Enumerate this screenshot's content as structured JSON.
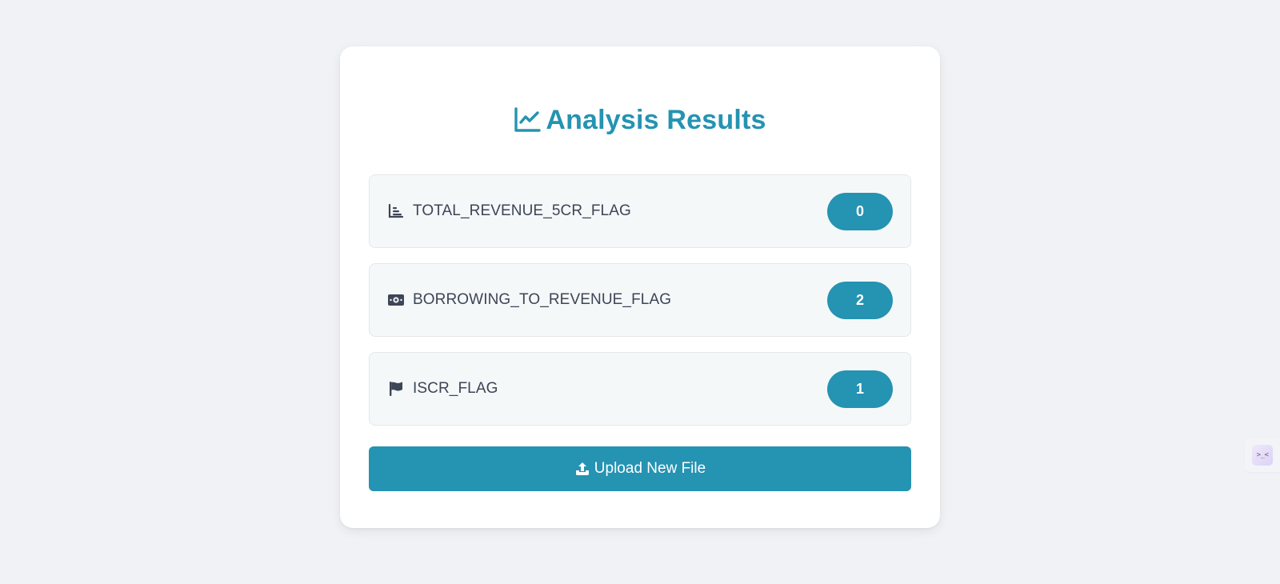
{
  "header": {
    "title": "Analysis Results",
    "icon": "line-chart-icon"
  },
  "results": [
    {
      "icon": "bar-chart-icon",
      "label": "TOTAL_REVENUE_5CR_FLAG",
      "value": "0"
    },
    {
      "icon": "money-bill-icon",
      "label": "BORROWING_TO_REVENUE_FLAG",
      "value": "2"
    },
    {
      "icon": "flag-icon",
      "label": "ISCR_FLAG",
      "value": "1"
    }
  ],
  "actions": {
    "upload_label": "Upload New File",
    "upload_icon": "upload-icon"
  },
  "side_widget": {
    "glyph": ">_<"
  },
  "colors": {
    "accent": "#2593b2",
    "background": "#f0f2f5",
    "row_background": "#f5f8f9",
    "label_text": "#3d4556"
  }
}
